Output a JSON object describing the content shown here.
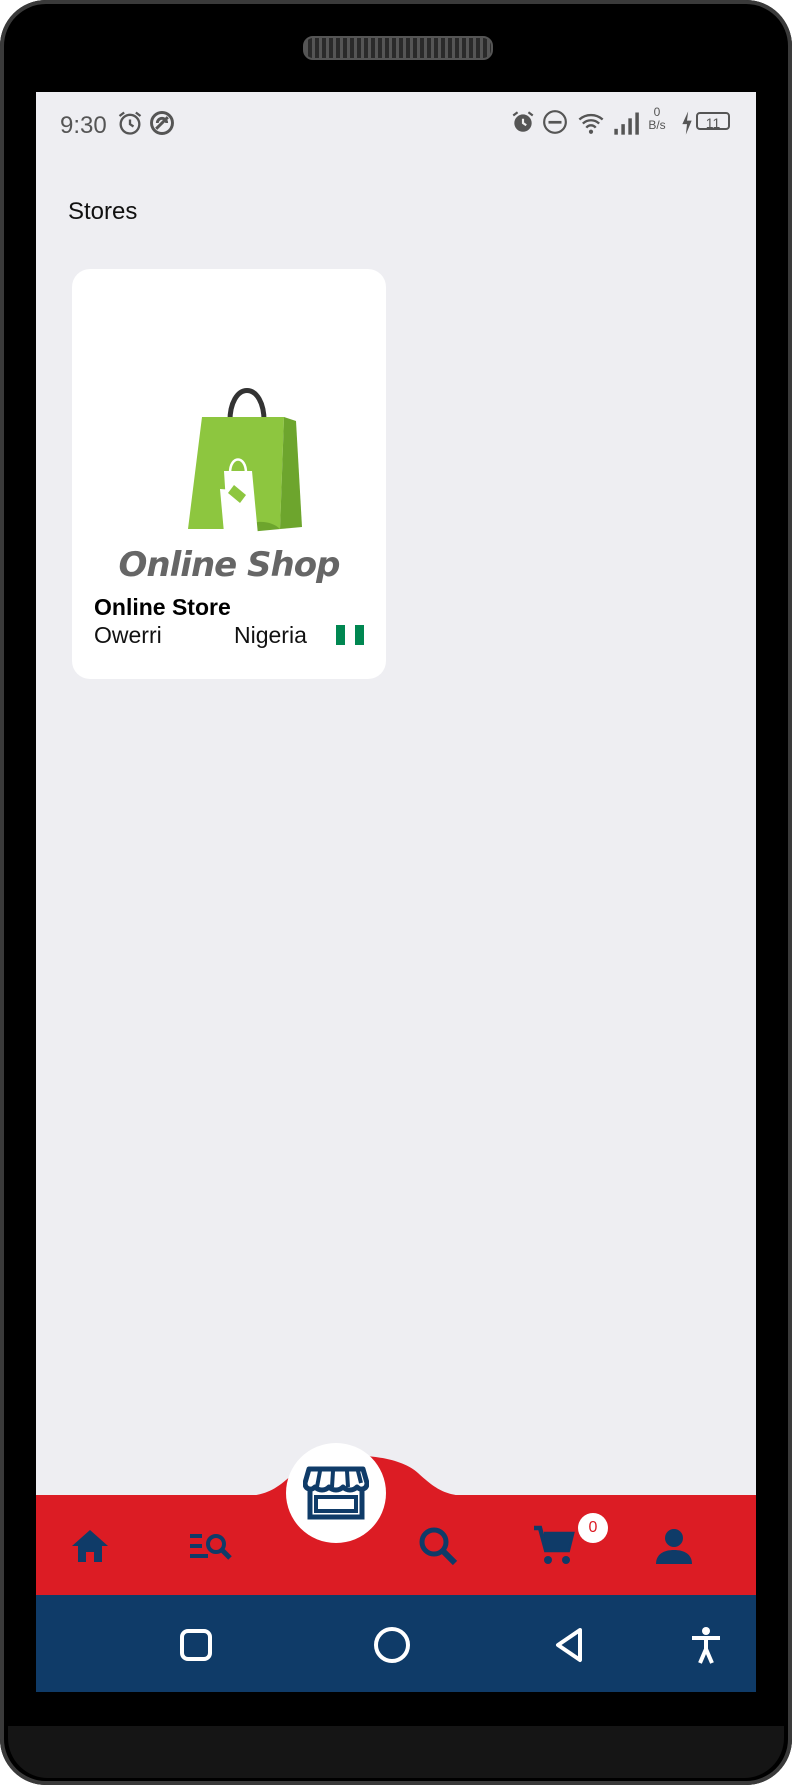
{
  "status_bar": {
    "time": "9:30",
    "net_speed_value": "0",
    "net_speed_unit": "B/s",
    "battery": "11",
    "icons": [
      "alarm-icon",
      "sync-icon",
      "alarm-icon",
      "do-not-disturb-icon",
      "wifi-icon",
      "signal-icon",
      "charging-icon",
      "battery-icon"
    ]
  },
  "page": {
    "title": "Stores"
  },
  "stores": [
    {
      "logo_text": "Online Shop",
      "name": "Online Store",
      "city": "Owerri",
      "country": "Nigeria",
      "flag_colors": [
        "#008751",
        "#ffffff",
        "#008751"
      ]
    }
  ],
  "bottom_nav": {
    "items": [
      "home-icon",
      "search-list-icon",
      "store-icon",
      "search-icon",
      "cart-icon",
      "profile-icon"
    ],
    "cart_count": "0",
    "colors": {
      "background": "#dc1c24",
      "icon": "#0f3b68"
    }
  },
  "system_nav": {
    "items": [
      "recents-icon",
      "home-circle-icon",
      "back-icon",
      "accessibility-icon"
    ],
    "background": "#0f3b68"
  }
}
